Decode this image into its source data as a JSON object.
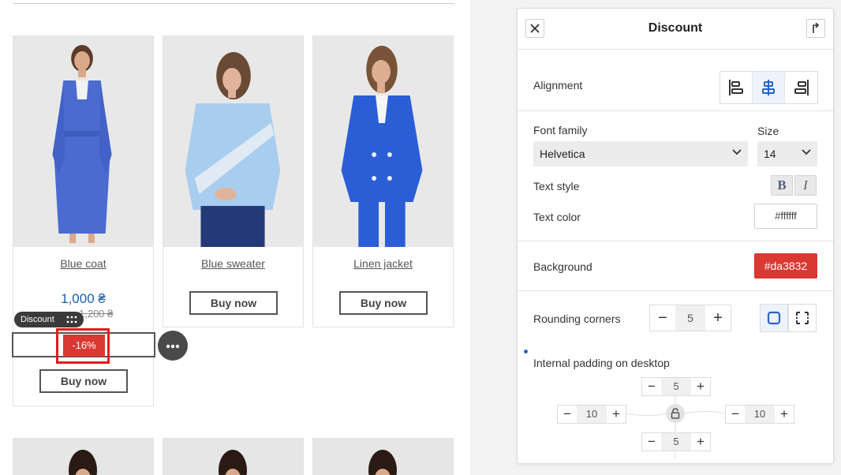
{
  "canvas": {
    "products": [
      {
        "name": "Blue coat",
        "price": "1,000 ₴",
        "old_price": "1,200 ₴",
        "buy_label": "Buy now"
      },
      {
        "name": "Blue sweater",
        "buy_label": "Buy now"
      },
      {
        "name": "Linen jacket",
        "buy_label": "Buy now"
      }
    ],
    "discount_block": {
      "tag_label": "Discount",
      "badge_text": "-16%"
    }
  },
  "panel": {
    "title": "Discount",
    "alignment": {
      "label": "Alignment",
      "options": [
        "align-left-icon",
        "align-center-icon",
        "align-right-icon"
      ],
      "active": "center"
    },
    "font_family": {
      "label": "Font family",
      "value": "Helvetica"
    },
    "size": {
      "label": "Size",
      "value": "14"
    },
    "text_style": {
      "label": "Text style",
      "bold": "B",
      "italic": "I"
    },
    "text_color": {
      "label": "Text color",
      "value": "#ffffff"
    },
    "background": {
      "label": "Background",
      "value": "#da3832"
    },
    "rounding": {
      "label": "Rounding corners",
      "value": "5"
    },
    "padding": {
      "label": "Internal padding on desktop",
      "top": "5",
      "left": "10",
      "right": "10",
      "bottom": "5"
    }
  },
  "colors": {
    "accent": "#da3832",
    "selection": "#e11d1d",
    "price_blue": "#1c5ea8",
    "active_blue": "#2a62c8"
  }
}
